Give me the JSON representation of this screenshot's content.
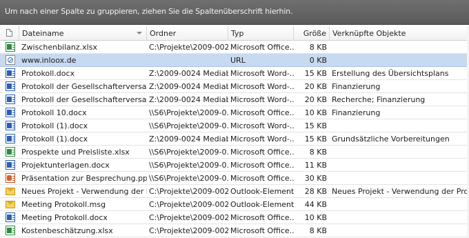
{
  "group_bar": {
    "hint": "Um nach einer Spalte zu gruppieren, ziehen Sie die Spaltenüberschrift hierhin."
  },
  "columns": {
    "dateiname": "Dateiname",
    "ordner": "Ordner",
    "typ": "Typ",
    "groesse": "Größe",
    "verknuepft": "Verknüpfte Objekte"
  },
  "rows": [
    {
      "icon": "excel-icon",
      "name": "Zwischenbilanz.xlsx",
      "folder": "C:\\Projekte\\2009-002...",
      "type": "Microsoft Office...",
      "size": "8 KB",
      "linked": "",
      "selected": false
    },
    {
      "icon": "url-icon",
      "name": "www.inloox.de",
      "folder": "",
      "type": "URL",
      "size": "0 KB",
      "linked": "",
      "selected": true
    },
    {
      "icon": "word-icon",
      "name": "Protokoll.docx",
      "folder": "Z:\\2009-0024 Mediab...",
      "type": "Microsoft Word-...",
      "size": "15 KB",
      "linked": "Erstellung des Übersichtsplans",
      "selected": false
    },
    {
      "icon": "word-icon",
      "name": "Protokoll der Gesellschafterversam...",
      "folder": "Z:\\2009-0024 Mediab...",
      "type": "Microsoft Word-...",
      "size": "20 KB",
      "linked": "Finanzierung",
      "selected": false
    },
    {
      "icon": "word-icon",
      "name": "Protokoll der Gesellschafterversam...",
      "folder": "Z:\\2009-0024 Mediab...",
      "type": "Microsoft Word-...",
      "size": "20 KB",
      "linked": "Recherche; Finanzierung",
      "selected": false
    },
    {
      "icon": "word-icon",
      "name": "Protokoll 10.docx",
      "folder": "\\\\S6\\Projekte\\2009-0...",
      "type": "Microsoft Office...",
      "size": "10 KB",
      "linked": "Finanzierung",
      "selected": false
    },
    {
      "icon": "word-icon",
      "name": "Protokoll (1).docx",
      "folder": "\\\\S6\\Projekte\\2009-0...",
      "type": "Microsoft Word-...",
      "size": "15 KB",
      "linked": "",
      "selected": false
    },
    {
      "icon": "word-icon",
      "name": "Protokoll (1).docx",
      "folder": "Z:\\2009-0024 Mediab...",
      "type": "Microsoft Word-...",
      "size": "15 KB",
      "linked": "Grundsätzliche Vorbereitungen",
      "selected": false
    },
    {
      "icon": "excel-icon",
      "name": "Prospekte und Preisliste.xlsx",
      "folder": "\\\\S6\\Projekte\\2009-0...",
      "type": "Microsoft Office...",
      "size": "8 KB",
      "linked": "",
      "selected": false
    },
    {
      "icon": "word-icon",
      "name": "Projektunterlagen.docx",
      "folder": "\\\\S6\\Projekte\\2009-0...",
      "type": "Microsoft Office...",
      "size": "11 KB",
      "linked": "",
      "selected": false
    },
    {
      "icon": "ppt-icon",
      "name": "Präsentation zur Besprechung.pptx",
      "folder": "\\\\S6\\Projekte\\2009-0...",
      "type": "Microsoft Office...",
      "size": "30 KB",
      "linked": "",
      "selected": false
    },
    {
      "icon": "mail-icon",
      "name": "Neues Projekt - Verwendung der Pr...",
      "folder": "C:\\Projekte\\2009-002...",
      "type": "Outlook-Element",
      "size": "28 KB",
      "linked": "Neues Projekt - Verwendung der Projektm",
      "selected": false
    },
    {
      "icon": "mail-icon",
      "name": "Meeting Protokoll.msg",
      "folder": "C:\\Projekte\\2009-002...",
      "type": "Outlook-Element",
      "size": "44 KB",
      "linked": "",
      "selected": false
    },
    {
      "icon": "word-icon",
      "name": "Meeting Protokoll.docx",
      "folder": "C:\\Projekte\\2009-002...",
      "type": "Microsoft Office...",
      "size": "10 KB",
      "linked": "",
      "selected": false
    },
    {
      "icon": "excel-icon",
      "name": "Kostenbeschätzung.xlsx",
      "folder": "C:\\Projekte\\2009-002...",
      "type": "Microsoft Office...",
      "size": "8 KB",
      "linked": "",
      "selected": false
    }
  ]
}
